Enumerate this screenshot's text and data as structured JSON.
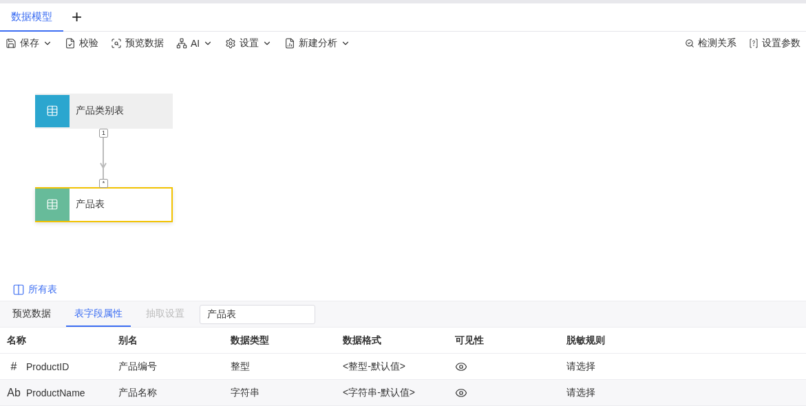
{
  "tabs": [
    {
      "label": "数据模型",
      "selected": true
    }
  ],
  "add_tab": "+",
  "toolbar": {
    "left": [
      {
        "kind": "save",
        "label": "保存",
        "dropdown": true
      },
      {
        "kind": "check",
        "label": "校验",
        "dropdown": false
      },
      {
        "kind": "preview",
        "label": "预览数据",
        "dropdown": false
      },
      {
        "kind": "ai",
        "label": "AI",
        "dropdown": true
      },
      {
        "kind": "settings",
        "label": "设置",
        "dropdown": true
      },
      {
        "kind": "analysis",
        "label": "新建分析",
        "dropdown": true
      }
    ],
    "right": [
      {
        "kind": "detect",
        "label": "检测关系"
      },
      {
        "kind": "params",
        "label": "设置参数"
      }
    ]
  },
  "canvas": {
    "nodes": [
      {
        "label": "产品类别表",
        "color": "#2ba6cf",
        "selected": false
      },
      {
        "label": "产品表",
        "color": "#67bb9a",
        "selected": true
      }
    ],
    "relation": {
      "from_label": "1",
      "to_label": "*"
    }
  },
  "all_tables": "所有表",
  "bottom_tabs": [
    {
      "label": "预览数据",
      "selected": false,
      "disabled": false
    },
    {
      "label": "表字段属性",
      "selected": true,
      "disabled": false
    },
    {
      "label": "抽取设置",
      "selected": false,
      "disabled": true
    }
  ],
  "table_select": {
    "value": "产品表"
  },
  "columns": [
    "名称",
    "别名",
    "数据类型",
    "数据格式",
    "可见性",
    "脱敏规则"
  ],
  "rows": [
    {
      "type_glyph": "#",
      "name": "ProductID",
      "alias": "产品编号",
      "type": "整型",
      "format": "<整型-默认值>",
      "visible": true,
      "mask": "请选择"
    },
    {
      "type_glyph": "Ab",
      "name": "ProductName",
      "alias": "产品名称",
      "type": "字符串",
      "format": "<字符串-默认值>",
      "visible": true,
      "mask": "请选择"
    }
  ]
}
